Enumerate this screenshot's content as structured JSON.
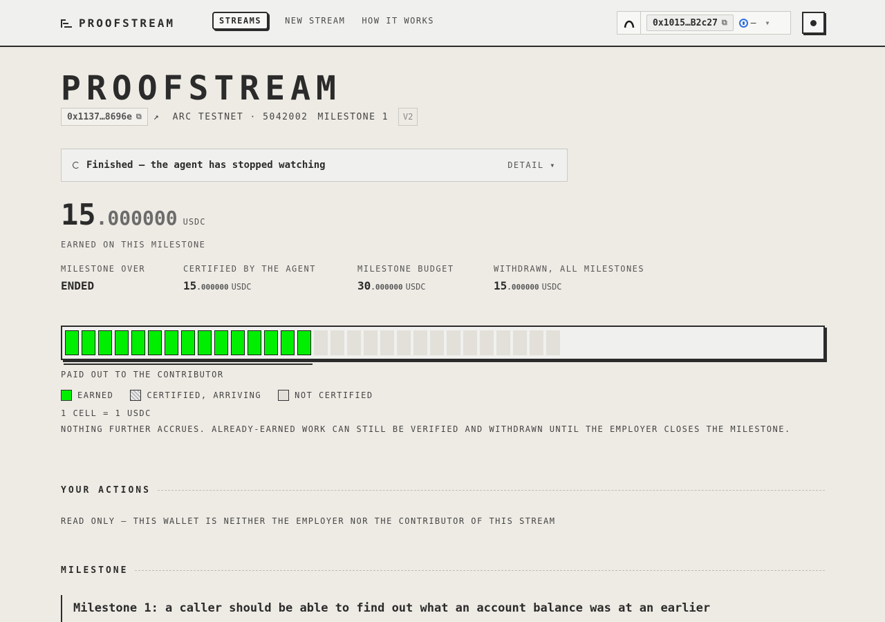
{
  "nav": {
    "logo": "PROOFSTREAM",
    "links": [
      "STREAMS",
      "NEW STREAM",
      "HOW IT WORKS"
    ],
    "wallet_address": "0x1015…B2c27",
    "chain_value": "–"
  },
  "header": {
    "title": "PROOFSTREAM",
    "stream_address": "0x1137…8696e",
    "network": "ARC TESTNET · 5042002",
    "milestone": "MILESTONE 1",
    "version": "V2"
  },
  "status": {
    "text": "Finished — the agent has stopped watching",
    "detail": "DETAIL ▾"
  },
  "amount": {
    "int": "15",
    "dec": ".000000",
    "unit": "USDC",
    "label": "EARNED ON THIS MILESTONE"
  },
  "stats": [
    {
      "label": "MILESTONE OVER",
      "value": "ENDED",
      "dec": "",
      "unit": ""
    },
    {
      "label": "CERTIFIED BY THE AGENT",
      "value": "15",
      "dec": ".000000",
      "unit": "USDC"
    },
    {
      "label": "MILESTONE BUDGET",
      "value": "30",
      "dec": ".000000",
      "unit": "USDC"
    },
    {
      "label": "WITHDRAWN, ALL MILESTONES",
      "value": "15",
      "dec": ".000000",
      "unit": "USDC"
    }
  ],
  "cells": {
    "earned": 15,
    "total": 30,
    "colors": {
      "earned": "#00ee00",
      "not_certified": "#e2e0d9"
    }
  },
  "paid_label": "PAID OUT TO THE CONTRIBUTOR",
  "legend": [
    "EARNED",
    "CERTIFIED, ARRIVING",
    "NOT CERTIFIED"
  ],
  "cell_note": "1 CELL = 1 USDC",
  "accrue_note": "NOTHING FURTHER ACCRUES. ALREADY-EARNED WORK CAN STILL BE VERIFIED AND WITHDRAWN UNTIL THE EMPLOYER CLOSES THE MILESTONE.",
  "actions": {
    "title": "YOUR ACTIONS",
    "readonly": "READ ONLY — THIS WALLET IS NEITHER THE EMPLOYER NOR THE CONTRIBUTOR OF THIS STREAM"
  },
  "milestone_section": {
    "title": "MILESTONE",
    "text": "Milestone 1: a caller should be able to find out what an account balance was at an earlier"
  }
}
